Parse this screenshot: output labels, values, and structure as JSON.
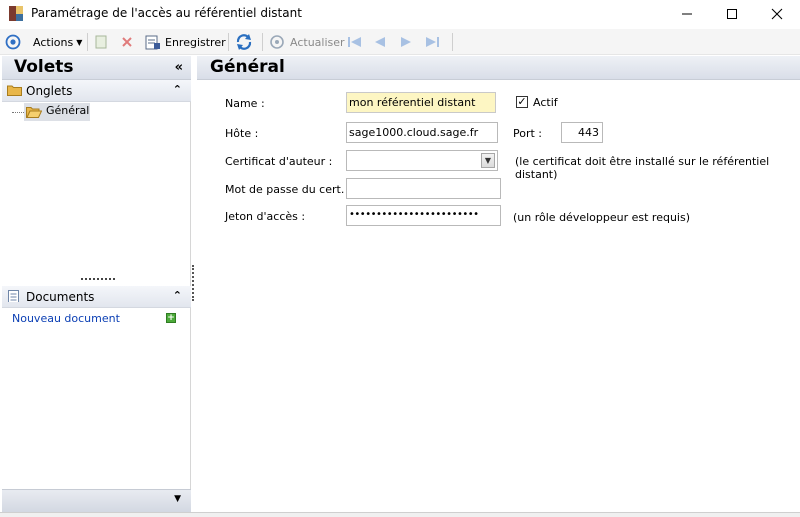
{
  "window": {
    "title": "Paramétrage de l'accès au référentiel distant"
  },
  "toolbar": {
    "actions_label": "Actions",
    "save_label": "Enregistrer",
    "refresh_label": "Actualiser"
  },
  "left_panel": {
    "title": "Volets",
    "collapse_symbol": "«",
    "onglets": {
      "label": "Onglets",
      "items": [
        {
          "label": "Général"
        }
      ]
    },
    "documents": {
      "label": "Documents",
      "new_document": "Nouveau document",
      "add_symbol": "+"
    }
  },
  "content": {
    "title": "Général",
    "name_label": "Name :",
    "name_value": "mon référentiel distant",
    "actif_label": "Actif",
    "actif_checked": true,
    "host_label": "Hôte :",
    "host_value": "sage1000.cloud.sage.fr",
    "port_label": "Port :",
    "port_value": "443",
    "cert_label": "Certificat d'auteur :",
    "cert_value": "",
    "cert_note": "(le certificat doit être installé sur le référentiel distant)",
    "cert_password_label": "Mot de passe du cert. :",
    "cert_password_value": "",
    "token_label": "Jeton d'accès :",
    "token_value": "••••••••••••••••••••••••",
    "token_note": "(un rôle développeur est requis)"
  },
  "colors": {
    "required_field_bg": "#fdf6c3",
    "link": "#0b3fb4",
    "panel_header": "#d9dee8"
  },
  "icons": [
    "app-icon",
    "minimize-icon",
    "maximize-icon",
    "close-icon",
    "actions-icon",
    "new-icon",
    "delete-icon",
    "save-icon",
    "sync-icon",
    "refresh-icon",
    "first-icon",
    "previous-icon",
    "next-icon",
    "last-icon",
    "folder-icon",
    "open-folder-icon",
    "document-icon",
    "add-icon"
  ]
}
